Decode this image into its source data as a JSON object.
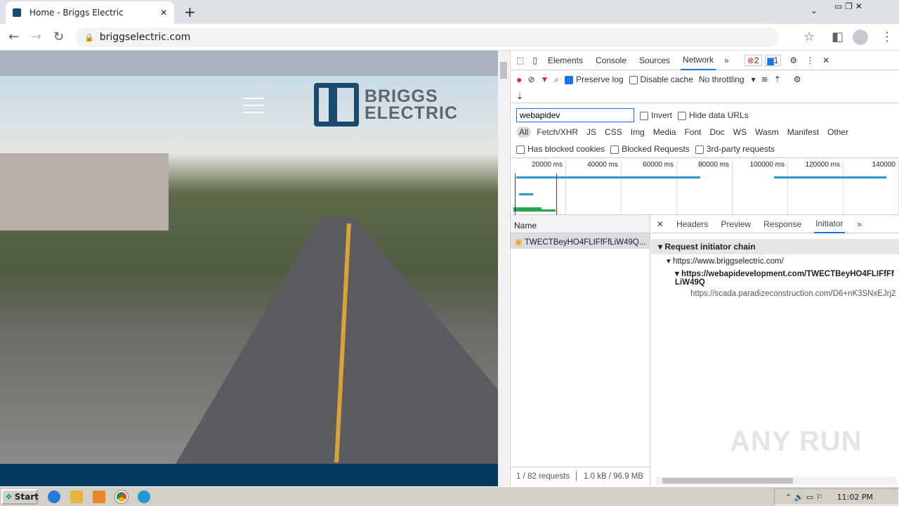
{
  "browser": {
    "tab_title": "Home - Briggs Electric",
    "url": "briggselectric.com"
  },
  "site": {
    "logo_line1": "BRIGGS",
    "logo_line2": "ELECTRIC"
  },
  "devtools": {
    "tabs": [
      "Elements",
      "Console",
      "Sources",
      "Network"
    ],
    "errors": "2",
    "messages": "1",
    "preserve_log": "Preserve log",
    "disable_cache": "Disable cache",
    "throttling": "No throttling",
    "filter_value": "webapidev",
    "invert": "Invert",
    "hide_data_urls": "Hide data URLs",
    "types": [
      "All",
      "Fetch/XHR",
      "JS",
      "CSS",
      "Img",
      "Media",
      "Font",
      "Doc",
      "WS",
      "Wasm",
      "Manifest",
      "Other"
    ],
    "has_blocked_cookies": "Has blocked cookies",
    "blocked_requests": "Blocked Requests",
    "third_party": "3rd-party requests",
    "ticks": [
      "20000 ms",
      "40000 ms",
      "60000 ms",
      "80000 ms",
      "100000 ms",
      "120000 ms",
      "140000"
    ],
    "name_header": "Name",
    "request_name": "TWECTBeyHO4FLIFfFfLiW49Q...",
    "status_requests": "1 / 82 requests",
    "status_size": "1.0 kB / 96.9 MB",
    "detail_tabs": [
      "Headers",
      "Preview",
      "Response",
      "Initiator"
    ],
    "chain_header": "Request initiator chain",
    "chain": [
      "https://www.briggselectric.com/",
      "https://webapidevelopment.com/TWECTBeyHO4FLIFfFfLiW49Q",
      "https://scada.paradizeconstruction.com/D6+nK3SNxEJrj2"
    ]
  },
  "watermark": "ANY RUN",
  "taskbar": {
    "start": "Start",
    "time": "11:02 PM"
  }
}
